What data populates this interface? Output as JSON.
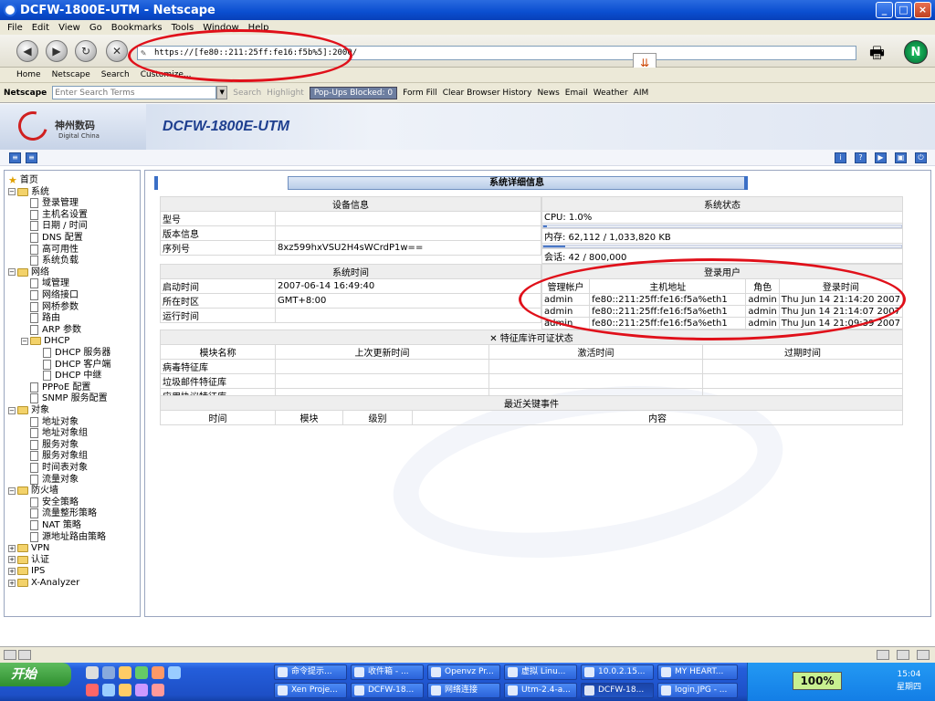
{
  "window": {
    "title": "DCFW-1800E-UTM - Netscape"
  },
  "menu": [
    "File",
    "Edit",
    "View",
    "Go",
    "Bookmarks",
    "Tools",
    "Window",
    "Help"
  ],
  "nav": {
    "url": "https://[fe80::211:25ff:fe16:f5b%5]:2000/"
  },
  "personal_toolbar": [
    "Home",
    "Netscape",
    "Search",
    "Customize..."
  ],
  "search_toolbar": {
    "brand": "Netscape",
    "placeholder": "Enter Search Terms",
    "search": "Search",
    "highlight": "Highlight",
    "popups": "Pop-Ups Blocked: 0",
    "form_fill": "Form Fill",
    "clear_history": "Clear Browser History",
    "links": [
      "News",
      "Email",
      "Weather",
      "AIM"
    ]
  },
  "app": {
    "logo_cn": "神州数码",
    "logo_en": "Digital China",
    "title": "DCFW-1800E-UTM"
  },
  "tree": [
    {
      "label": "首页",
      "type": "home",
      "level": 0
    },
    {
      "label": "系统",
      "type": "folder",
      "level": 0
    },
    {
      "label": "登录管理",
      "type": "doc",
      "level": 1
    },
    {
      "label": "主机名设置",
      "type": "doc",
      "level": 1
    },
    {
      "label": "日期 / 时间",
      "type": "doc",
      "level": 1
    },
    {
      "label": "DNS 配置",
      "type": "doc",
      "level": 1
    },
    {
      "label": "高可用性",
      "type": "doc",
      "level": 1
    },
    {
      "label": "系统负载",
      "type": "doc",
      "level": 1
    },
    {
      "label": "网络",
      "type": "folder",
      "level": 0
    },
    {
      "label": "域管理",
      "type": "doc",
      "level": 1
    },
    {
      "label": "网络接口",
      "type": "doc",
      "level": 1
    },
    {
      "label": "网桥参数",
      "type": "doc",
      "level": 1
    },
    {
      "label": "路由",
      "type": "doc",
      "level": 1
    },
    {
      "label": "ARP 参数",
      "type": "doc",
      "level": 1
    },
    {
      "label": "DHCP",
      "type": "folder",
      "level": 1
    },
    {
      "label": "DHCP 服务器",
      "type": "doc",
      "level": 2
    },
    {
      "label": "DHCP 客户端",
      "type": "doc",
      "level": 2
    },
    {
      "label": "DHCP 中继",
      "type": "doc",
      "level": 2
    },
    {
      "label": "PPPoE 配置",
      "type": "doc",
      "level": 1
    },
    {
      "label": "SNMP 服务配置",
      "type": "doc",
      "level": 1
    },
    {
      "label": "对象",
      "type": "folder",
      "level": 0
    },
    {
      "label": "地址对象",
      "type": "doc",
      "level": 1
    },
    {
      "label": "地址对象组",
      "type": "doc",
      "level": 1
    },
    {
      "label": "服务对象",
      "type": "doc",
      "level": 1
    },
    {
      "label": "服务对象组",
      "type": "doc",
      "level": 1
    },
    {
      "label": "时间表对象",
      "type": "doc",
      "level": 1
    },
    {
      "label": "流量对象",
      "type": "doc",
      "level": 1
    },
    {
      "label": "防火墙",
      "type": "folder",
      "level": 0
    },
    {
      "label": "安全策略",
      "type": "doc",
      "level": 1
    },
    {
      "label": "流量整形策略",
      "type": "doc",
      "level": 1
    },
    {
      "label": "NAT 策略",
      "type": "doc",
      "level": 1
    },
    {
      "label": "源地址路由策略",
      "type": "doc",
      "level": 1
    },
    {
      "label": "VPN",
      "type": "folder-closed",
      "level": 0
    },
    {
      "label": "认证",
      "type": "folder-closed",
      "level": 0
    },
    {
      "label": "IPS",
      "type": "folder-closed",
      "level": 0
    },
    {
      "label": "X-Analyzer",
      "type": "folder-closed",
      "level": 0
    }
  ],
  "main": {
    "panel_title": "系统详细信息",
    "device_info": {
      "header": "设备信息",
      "rows": [
        {
          "label": "型号",
          "value": ""
        },
        {
          "label": "版本信息",
          "value": ""
        },
        {
          "label": "序列号",
          "value": "8xz599hxVSU2H4sWCrdP1w=="
        }
      ]
    },
    "system_status": {
      "header": "系统状态",
      "cpu": "CPU: 1.0%",
      "cpu_fraction": 0.01,
      "mem": "内存: 62,112 / 1,033,820 KB",
      "mem_fraction": 0.06,
      "session": "会话: 42 / 800,000",
      "session_fraction": 0.0001
    },
    "system_time": {
      "header": "系统时间",
      "rows": [
        {
          "label": "启动时间",
          "value": "2007-06-14 16:49:40"
        },
        {
          "label": "所在时区",
          "value": "GMT+8:00"
        },
        {
          "label": "运行时间",
          "value": ""
        }
      ]
    },
    "login_users": {
      "header": "登录用户",
      "columns": [
        "管理帐户",
        "主机地址",
        "角色",
        "登录时间"
      ],
      "rows": [
        [
          "admin",
          "fe80::211:25ff:fe16:f5a%eth1",
          "admin",
          "Thu Jun 14 21:14:20 2007"
        ],
        [
          "admin",
          "fe80::211:25ff:fe16:f5a%eth1",
          "admin",
          "Thu Jun 14 21:14:07 2007"
        ],
        [
          "admin",
          "fe80::211:25ff:fe16:f5a%eth1",
          "admin",
          "Thu Jun 14 21:09:39 2007"
        ]
      ]
    },
    "license": {
      "header": "特征库许可证状态",
      "columns": [
        "模块名称",
        "上次更新时间",
        "激活时间",
        "过期时间"
      ],
      "rows": [
        "病毒特征库",
        "垃圾邮件特征库",
        "应用协议特征库"
      ]
    },
    "events": {
      "header": "最近关键事件",
      "columns": [
        "时间",
        "模块",
        "级别",
        "内容"
      ]
    }
  },
  "taskbar": {
    "start": "开始",
    "tasks_top": [
      "命令提示...",
      "收件箱 - ...",
      "Openvz Pr...",
      "虚拟 Linu...",
      "10.0.2.15...",
      "MY HEART..."
    ],
    "tasks_bottom": [
      "Xen Proje...",
      "DCFW-18...",
      "网络连接",
      "Utm-2.4-a...",
      "DCFW-18...",
      "login.JPG - ..."
    ],
    "zoom": "100%",
    "time": "15:04",
    "weekday": "星期四"
  },
  "colors": {
    "highlight_red": "#e0101a",
    "brand_blue": "#1e3f8f",
    "taskbar_blue": "#245edb"
  }
}
